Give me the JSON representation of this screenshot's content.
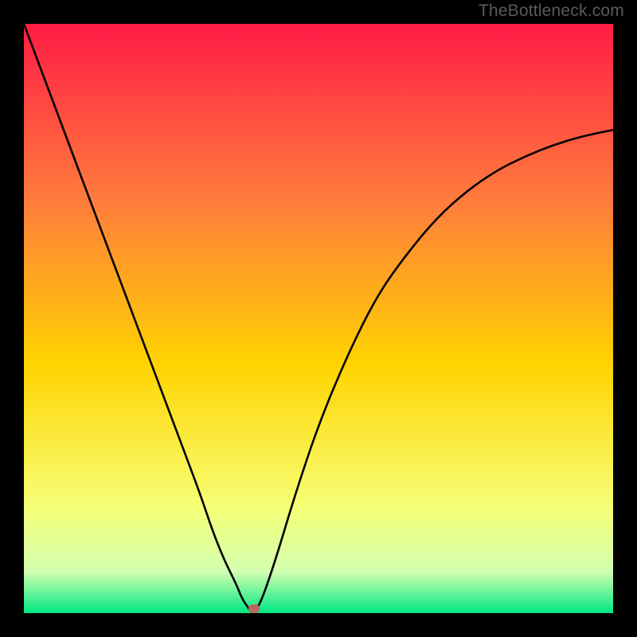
{
  "watermark": "TheBottleneck.com",
  "gradient": {
    "top_color": "#ff1c46",
    "upper_mid_color": "#ff7c3c",
    "mid_color": "#ffd400",
    "lower_mid_color": "#f6ff76",
    "near_bottom_color": "#d2ffb0",
    "bottom_color": "#00e884"
  },
  "curve": {
    "stroke": "#000000",
    "stroke_width": 2.6,
    "min_marker_color": "#b96a5c"
  },
  "chart_data": {
    "type": "line",
    "title": "",
    "xlabel": "",
    "ylabel": "",
    "xlim": [
      0,
      100
    ],
    "ylim": [
      0,
      100
    ],
    "x": [
      0,
      3,
      6,
      9,
      12,
      15,
      18,
      21,
      24,
      27,
      30,
      32,
      34,
      36,
      37,
      38,
      38.5,
      39,
      40,
      41,
      43,
      46,
      50,
      55,
      60,
      65,
      70,
      75,
      80,
      85,
      90,
      95,
      100
    ],
    "values": [
      100,
      92,
      84,
      76,
      68,
      60,
      52,
      44,
      36,
      28,
      20,
      14,
      9,
      5,
      2.5,
      1,
      0.3,
      0,
      1.5,
      4,
      10,
      20,
      32,
      44,
      54,
      61,
      67,
      71.5,
      75,
      77.5,
      79.5,
      81,
      82
    ],
    "minimum_x": 39,
    "annotations": []
  }
}
